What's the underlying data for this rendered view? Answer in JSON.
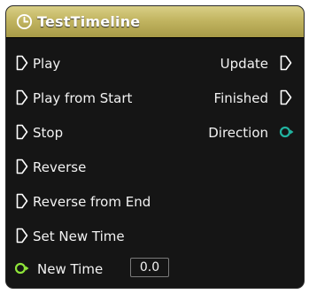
{
  "node": {
    "title": "TestTimeline",
    "title_icon": "clock-icon",
    "header_color": "#c2b561",
    "exec_inputs": [
      {
        "label": "Play"
      },
      {
        "label": "Play from Start"
      },
      {
        "label": "Stop"
      },
      {
        "label": "Reverse"
      },
      {
        "label": "Reverse from End"
      },
      {
        "label": "Set New Time"
      }
    ],
    "outputs": [
      {
        "label": "Update",
        "pin": "exec-pin-icon"
      },
      {
        "label": "Finished",
        "pin": "exec-pin-icon"
      },
      {
        "label": "Direction",
        "pin": "data-pin-icon",
        "color": "#21b3a0"
      }
    ],
    "new_time": {
      "label": "New Time",
      "value": "0.0",
      "pin_color": "#8fe53a"
    }
  }
}
